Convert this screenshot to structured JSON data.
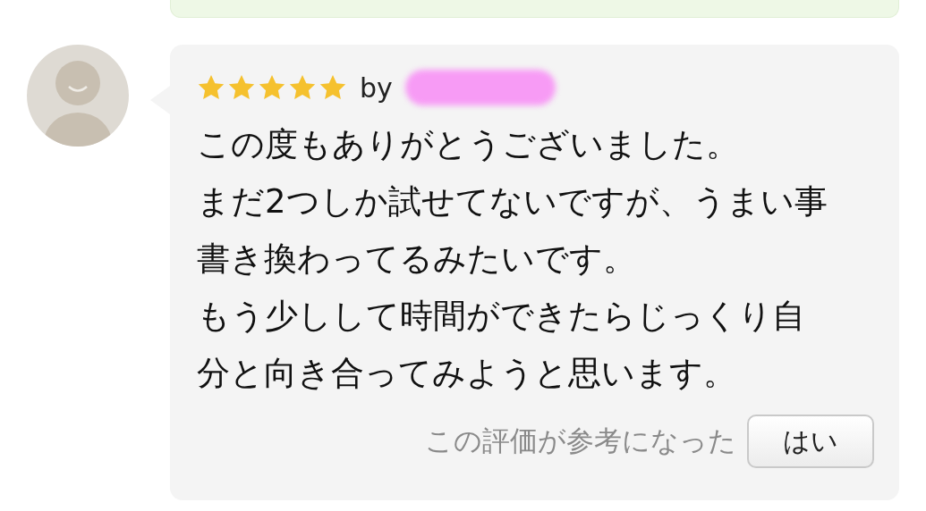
{
  "review": {
    "stars": 5,
    "by": "by",
    "author_redacted": true,
    "lines": [
      "この度もありがとうございました。",
      "まだ2つしか試せてないですが、うまい事",
      "書き換わってるみたいです。",
      "もう少しして時間ができたらじっくり自",
      "分と向き合ってみようと思います。"
    ],
    "helpful_prompt": "この評価が参考になった",
    "helpful_button": "はい"
  }
}
